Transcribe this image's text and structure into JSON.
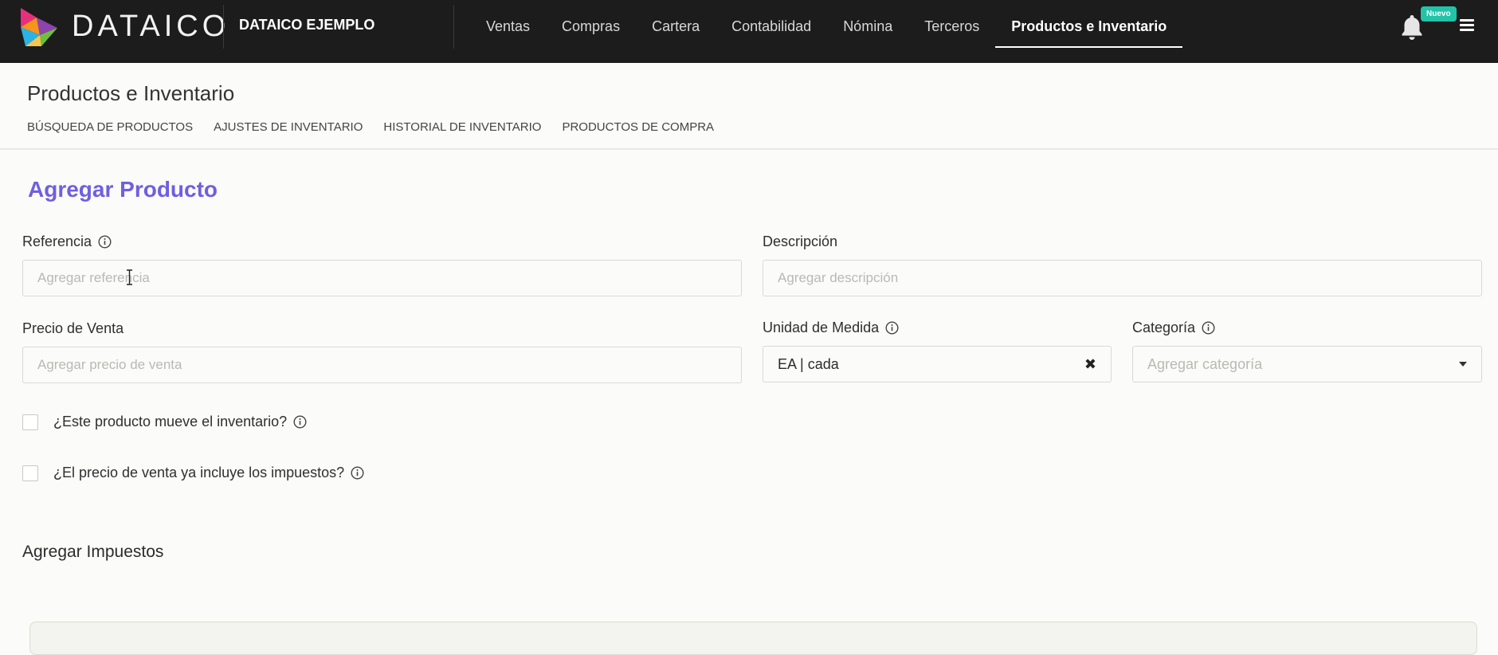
{
  "brand": {
    "name": "DATAICO",
    "company": "DATAICO EJEMPLO"
  },
  "nav": {
    "items": [
      {
        "label": "Ventas"
      },
      {
        "label": "Compras"
      },
      {
        "label": "Cartera"
      },
      {
        "label": "Contabilidad"
      },
      {
        "label": "Nómina"
      },
      {
        "label": "Terceros"
      },
      {
        "label": "Productos e Inventario"
      }
    ],
    "active": "Productos e Inventario",
    "badge": "Nuevo"
  },
  "section": {
    "title": "Productos e Inventario",
    "tabs": [
      {
        "label": "BÚSQUEDA DE PRODUCTOS"
      },
      {
        "label": "AJUSTES DE INVENTARIO"
      },
      {
        "label": "HISTORIAL DE INVENTARIO"
      },
      {
        "label": "PRODUCTOS DE COMPRA"
      }
    ]
  },
  "form": {
    "title": "Agregar Producto",
    "referencia": {
      "label": "Referencia",
      "placeholder": "Agregar referencia",
      "value": ""
    },
    "descripcion": {
      "label": "Descripción",
      "placeholder": "Agregar descripción",
      "value": ""
    },
    "precio": {
      "label": "Precio de Venta",
      "placeholder": "Agregar precio de venta",
      "value": ""
    },
    "unidad": {
      "label": "Unidad de Medida",
      "value": "EA | cada"
    },
    "categoria": {
      "label": "Categoría",
      "placeholder": "Agregar categoría"
    },
    "check_inventario": {
      "label": "¿Este producto mueve el inventario?",
      "checked": false
    },
    "check_impuestos": {
      "label": "¿El precio de venta ya incluye los impuestos?",
      "checked": false
    },
    "taxes_heading": "Agregar Impuestos"
  },
  "colors": {
    "navbar": "#1c1c1c",
    "accent": "#6f5fe0",
    "badge": "#22c3a8",
    "background": "#fbfbf9"
  },
  "icons": {
    "logo": "dataico-triangle-logo",
    "info": "info-circle-icon",
    "bell": "bell-icon",
    "menu": "hamburger-menu-icon",
    "clear": "close-x-icon",
    "dropdown": "caret-down-icon"
  }
}
